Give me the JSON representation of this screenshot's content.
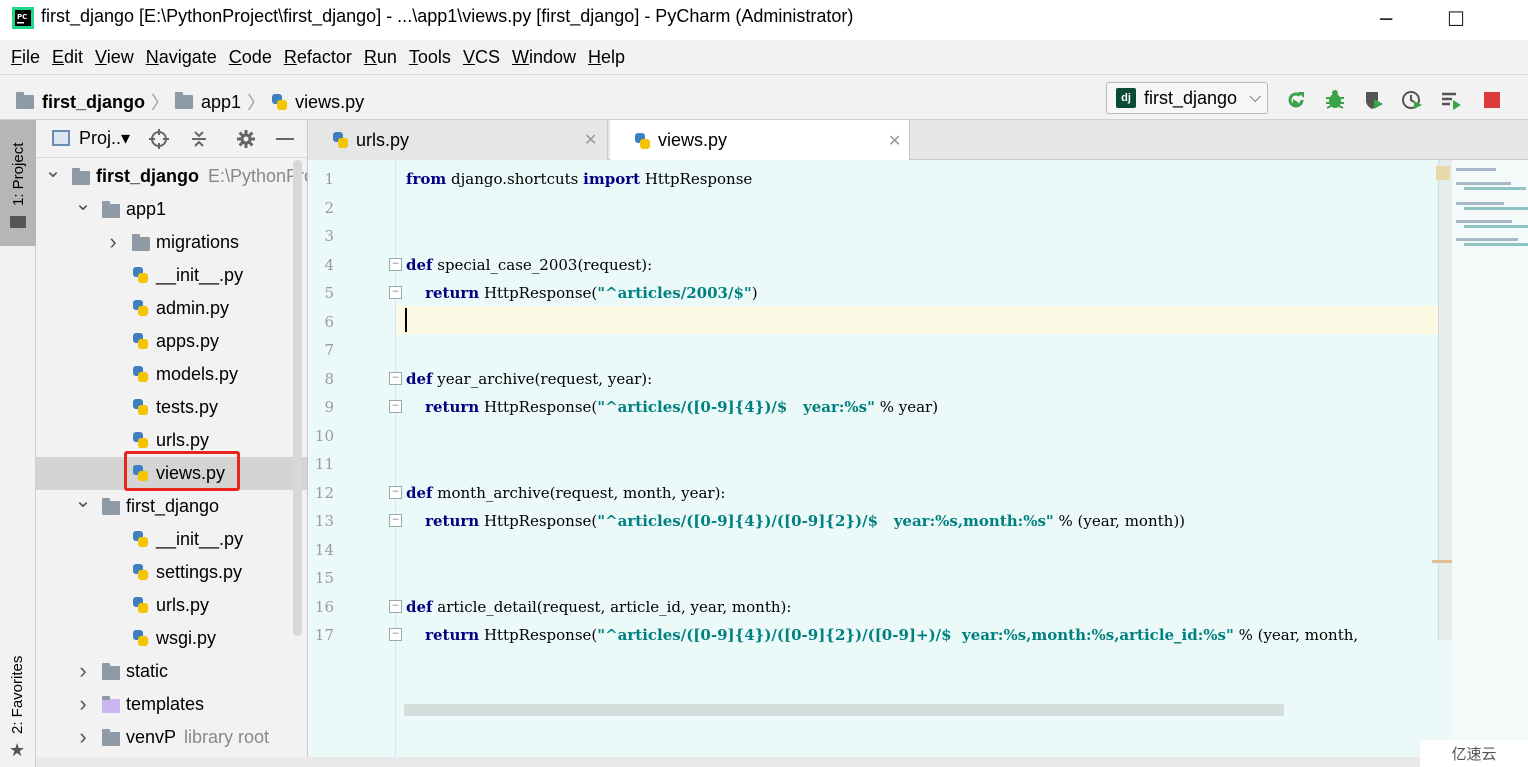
{
  "window": {
    "title": "first_django [E:\\PythonProject\\first_django] - ...\\app1\\views.py [first_django] - PyCharm (Administrator)",
    "app_icon": "pycharm-icon",
    "minimize": "─",
    "maximize": "☐"
  },
  "menu": [
    "File",
    "Edit",
    "View",
    "Navigate",
    "Code",
    "Refactor",
    "Run",
    "Tools",
    "VCS",
    "Window",
    "Help"
  ],
  "breadcrumb": {
    "project": "first_django",
    "folder": "app1",
    "file": "views.py",
    "separator": "〉"
  },
  "run_config": {
    "badge": "dj",
    "name": "first_django",
    "arrow": "⌵"
  },
  "toolbar_icons": [
    "rerun-icon",
    "debug-icon",
    "coverage-icon",
    "profile-icon",
    "concurrency-icon",
    "stop-icon"
  ],
  "left_strip": {
    "project_tab": "1: Project",
    "favorites_tab": "2: Favorites"
  },
  "project_panel": {
    "header_label": "Proj..▾",
    "tree": [
      {
        "label": "first_django",
        "hint": "E:\\PythonProj",
        "type": "folder",
        "depth": 0,
        "expanded": true,
        "bold": true
      },
      {
        "label": "app1",
        "type": "folder",
        "depth": 1,
        "expanded": true
      },
      {
        "label": "migrations",
        "type": "folder",
        "depth": 2,
        "expanded": false
      },
      {
        "label": "__init__.py",
        "type": "py",
        "depth": 2
      },
      {
        "label": "admin.py",
        "type": "py",
        "depth": 2
      },
      {
        "label": "apps.py",
        "type": "py",
        "depth": 2
      },
      {
        "label": "models.py",
        "type": "py",
        "depth": 2
      },
      {
        "label": "tests.py",
        "type": "py",
        "depth": 2
      },
      {
        "label": "urls.py",
        "type": "py",
        "depth": 2
      },
      {
        "label": "views.py",
        "type": "py",
        "depth": 2,
        "selected": true
      },
      {
        "label": "first_django",
        "type": "folder",
        "depth": 1,
        "expanded": true
      },
      {
        "label": "__init__.py",
        "type": "py",
        "depth": 2
      },
      {
        "label": "settings.py",
        "type": "py",
        "depth": 2
      },
      {
        "label": "urls.py",
        "type": "py",
        "depth": 2
      },
      {
        "label": "wsgi.py",
        "type": "py",
        "depth": 2
      },
      {
        "label": "static",
        "type": "folder",
        "depth": 1,
        "expanded": false
      },
      {
        "label": "templates",
        "type": "folder-purple",
        "depth": 1,
        "expanded": false
      },
      {
        "label": "venvP",
        "hint": "library root",
        "type": "folder",
        "depth": 1,
        "expanded": false
      }
    ]
  },
  "tabs": [
    {
      "label": "urls.py",
      "active": false
    },
    {
      "label": "views.py",
      "active": true
    }
  ],
  "editor": {
    "current_line": 6,
    "lines": [
      {
        "n": "1",
        "segments": [
          [
            "kw",
            "from"
          ],
          [
            "t",
            " django.shortcuts "
          ],
          [
            "kw",
            "import"
          ],
          [
            "t",
            " HttpResponse"
          ]
        ]
      },
      {
        "n": "2",
        "segments": []
      },
      {
        "n": "3",
        "segments": []
      },
      {
        "n": "4",
        "segments": [
          [
            "kw",
            "def"
          ],
          [
            "t",
            " special_case_2003(request):"
          ]
        ],
        "fold": "start"
      },
      {
        "n": "5",
        "segments": [
          [
            "t",
            "    "
          ],
          [
            "kw",
            "return"
          ],
          [
            "t",
            " HttpResponse("
          ],
          [
            "str",
            "\"^articles/2003/$\""
          ],
          [
            "t",
            ")"
          ]
        ],
        "fold": "end"
      },
      {
        "n": "6",
        "segments": []
      },
      {
        "n": "7",
        "segments": []
      },
      {
        "n": "8",
        "segments": [
          [
            "kw",
            "def"
          ],
          [
            "t",
            " year_archive(request, year):"
          ]
        ],
        "fold": "start"
      },
      {
        "n": "9",
        "segments": [
          [
            "t",
            "    "
          ],
          [
            "kw",
            "return"
          ],
          [
            "t",
            " HttpResponse("
          ],
          [
            "str",
            "\"^articles/([0-9]{4})/$   year:%s\""
          ],
          [
            "t",
            " % year)"
          ]
        ],
        "fold": "end"
      },
      {
        "n": "10",
        "segments": []
      },
      {
        "n": "11",
        "segments": []
      },
      {
        "n": "12",
        "segments": [
          [
            "kw",
            "def"
          ],
          [
            "t",
            " month_archive(request, month, year):"
          ]
        ],
        "fold": "start"
      },
      {
        "n": "13",
        "segments": [
          [
            "t",
            "    "
          ],
          [
            "kw",
            "return"
          ],
          [
            "t",
            " HttpResponse("
          ],
          [
            "str",
            "\"^articles/([0-9]{4})/([0-9]{2})/$   year:%s,month:%s\""
          ],
          [
            "t",
            " % (year, month))"
          ]
        ],
        "fold": "end"
      },
      {
        "n": "14",
        "segments": []
      },
      {
        "n": "15",
        "segments": []
      },
      {
        "n": "16",
        "segments": [
          [
            "kw",
            "def"
          ],
          [
            "t",
            " article_detail(request, article_id, year, month):"
          ]
        ],
        "fold": "start"
      },
      {
        "n": "17",
        "segments": [
          [
            "t",
            "    "
          ],
          [
            "kw",
            "return"
          ],
          [
            "t",
            " HttpResponse("
          ],
          [
            "str",
            "\"^articles/([0-9]{4})/([0-9]{2})/([0-9]+)/$  year:%s,month:%s,article_id:%s\""
          ],
          [
            "t",
            " % (year, month,"
          ]
        ],
        "fold": "end"
      }
    ]
  },
  "watermark": "亿速云",
  "colors": {
    "keyword": "#000080",
    "string": "#008080",
    "editor_bg": "#ecf9f9",
    "selection_outline": "#e8241b"
  }
}
